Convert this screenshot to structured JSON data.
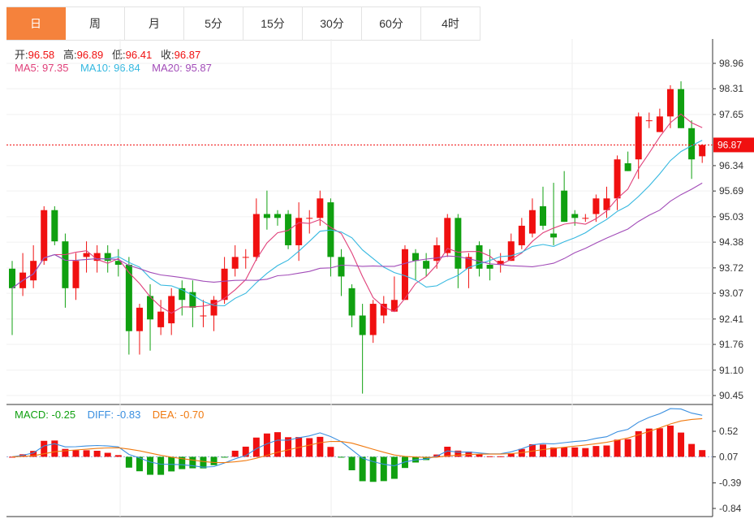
{
  "tabs": [
    "日",
    "周",
    "月",
    "5分",
    "15分",
    "30分",
    "60分",
    "4时"
  ],
  "active_tab": 0,
  "ohlc": {
    "open_label": "开:",
    "open": "96.58",
    "high_label": "高:",
    "high": "96.89",
    "low_label": "低:",
    "low": "96.41",
    "close_label": "收:",
    "close": "96.87"
  },
  "ma": {
    "ma5_label": "MA5: ",
    "ma5": "97.35",
    "ma10_label": "MA10: ",
    "ma10": "96.84",
    "ma20_label": "MA20: ",
    "ma20": "95.87"
  },
  "macd_info": {
    "macd_label": "MACD: ",
    "macd": "-0.25",
    "diff_label": "DIFF: ",
    "diff": "-0.83",
    "dea_label": "DEA: ",
    "dea": "-0.70"
  },
  "colors": {
    "up": "#f01010",
    "down": "#10a010",
    "ma5": "#e0407a",
    "ma10": "#35b8e0",
    "ma20": "#a24cb8",
    "diff": "#3a8fe0",
    "dea": "#f07a10",
    "tab_active": "#f5823c",
    "price_tag": "#f01010"
  },
  "chart_data": [
    {
      "type": "candlestick",
      "title": "",
      "y_ticks": [
        "98.96",
        "98.31",
        "97.65",
        "96.34",
        "95.69",
        "95.03",
        "94.38",
        "93.72",
        "93.07",
        "92.41",
        "91.76",
        "91.10",
        "90.45"
      ],
      "ylim": [
        90.45,
        98.96
      ],
      "current_price": "96.87",
      "candles": [
        [
          93.7,
          93.2,
          92.0,
          93.9
        ],
        [
          93.2,
          93.6,
          93.0,
          94.1
        ],
        [
          93.4,
          93.9,
          93.2,
          94.3
        ],
        [
          93.9,
          95.2,
          93.8,
          95.3
        ],
        [
          95.2,
          94.4,
          94.3,
          95.3
        ],
        [
          94.4,
          93.2,
          92.7,
          94.6
        ],
        [
          93.2,
          93.9,
          92.9,
          94.1
        ],
        [
          94.0,
          94.1,
          93.6,
          94.4
        ],
        [
          93.9,
          94.1,
          93.6,
          94.3
        ],
        [
          94.1,
          93.9,
          93.6,
          94.3
        ],
        [
          93.9,
          93.8,
          93.5,
          94.2
        ],
        [
          93.8,
          92.1,
          91.5,
          94.0
        ],
        [
          92.1,
          92.7,
          91.5,
          92.8
        ],
        [
          93.0,
          92.4,
          91.6,
          93.3
        ],
        [
          92.2,
          92.6,
          92.0,
          92.9
        ],
        [
          92.3,
          93.0,
          92.0,
          93.2
        ],
        [
          93.2,
          92.9,
          92.5,
          93.4
        ],
        [
          93.1,
          92.7,
          92.2,
          93.4
        ],
        [
          92.5,
          92.5,
          92.2,
          92.9
        ],
        [
          92.5,
          92.9,
          92.1,
          93.0
        ],
        [
          92.9,
          93.7,
          92.8,
          94.0
        ],
        [
          93.7,
          94.0,
          93.5,
          94.3
        ],
        [
          94.0,
          94.0,
          93.7,
          94.2
        ],
        [
          94.0,
          95.1,
          93.9,
          95.5
        ],
        [
          95.1,
          95.0,
          94.7,
          95.7
        ],
        [
          95.1,
          95.0,
          94.8,
          95.2
        ],
        [
          95.1,
          94.3,
          94.2,
          95.2
        ],
        [
          94.3,
          95.0,
          93.9,
          95.4
        ],
        [
          95.0,
          95.0,
          94.6,
          95.2
        ],
        [
          95.0,
          95.5,
          94.8,
          95.7
        ],
        [
          95.4,
          94.0,
          93.5,
          95.5
        ],
        [
          94.0,
          93.5,
          93.0,
          94.2
        ],
        [
          93.2,
          92.5,
          92.2,
          93.3
        ],
        [
          92.5,
          92.0,
          90.5,
          92.8
        ],
        [
          92.0,
          92.8,
          91.8,
          92.9
        ],
        [
          92.5,
          92.8,
          92.3,
          93.0
        ],
        [
          92.6,
          92.9,
          92.6,
          93.5
        ],
        [
          92.9,
          94.2,
          92.9,
          94.3
        ],
        [
          94.1,
          93.9,
          93.4,
          94.2
        ],
        [
          93.9,
          93.7,
          93.5,
          94.1
        ],
        [
          93.9,
          94.3,
          93.7,
          94.5
        ],
        [
          94.1,
          95.0,
          94.0,
          95.1
        ],
        [
          95.0,
          93.7,
          93.2,
          95.1
        ],
        [
          93.7,
          94.0,
          93.2,
          94.1
        ],
        [
          94.3,
          93.7,
          93.5,
          94.4
        ],
        [
          93.8,
          93.7,
          93.4,
          94.2
        ],
        [
          93.8,
          93.9,
          93.6,
          94.1
        ],
        [
          93.9,
          94.4,
          93.9,
          94.6
        ],
        [
          94.3,
          94.8,
          94.2,
          95.0
        ],
        [
          94.6,
          95.2,
          94.5,
          95.5
        ],
        [
          95.3,
          94.8,
          94.7,
          95.8
        ],
        [
          94.6,
          94.5,
          94.3,
          95.9
        ],
        [
          95.7,
          94.9,
          94.9,
          96.2
        ],
        [
          95.1,
          95.0,
          94.8,
          95.2
        ],
        [
          95.0,
          95.0,
          94.9,
          95.1
        ],
        [
          95.1,
          95.5,
          94.9,
          95.6
        ],
        [
          95.2,
          95.5,
          95.0,
          95.8
        ],
        [
          95.5,
          96.5,
          95.2,
          96.6
        ],
        [
          96.4,
          96.2,
          96.2,
          96.7
        ],
        [
          96.5,
          97.6,
          96.0,
          97.7
        ],
        [
          97.5,
          97.5,
          97.3,
          97.7
        ],
        [
          97.2,
          97.6,
          97.2,
          97.8
        ],
        [
          97.6,
          98.3,
          97.3,
          98.4
        ],
        [
          98.3,
          97.3,
          97.3,
          98.5
        ],
        [
          97.3,
          96.5,
          96.0,
          97.5
        ],
        [
          96.58,
          96.87,
          96.41,
          96.89
        ]
      ]
    },
    {
      "type": "bar+line",
      "title": "",
      "y_ticks": [
        "0.52",
        "0.07",
        "-0.39",
        "-0.84"
      ],
      "ylim": [
        -0.84,
        0.52
      ]
    }
  ]
}
